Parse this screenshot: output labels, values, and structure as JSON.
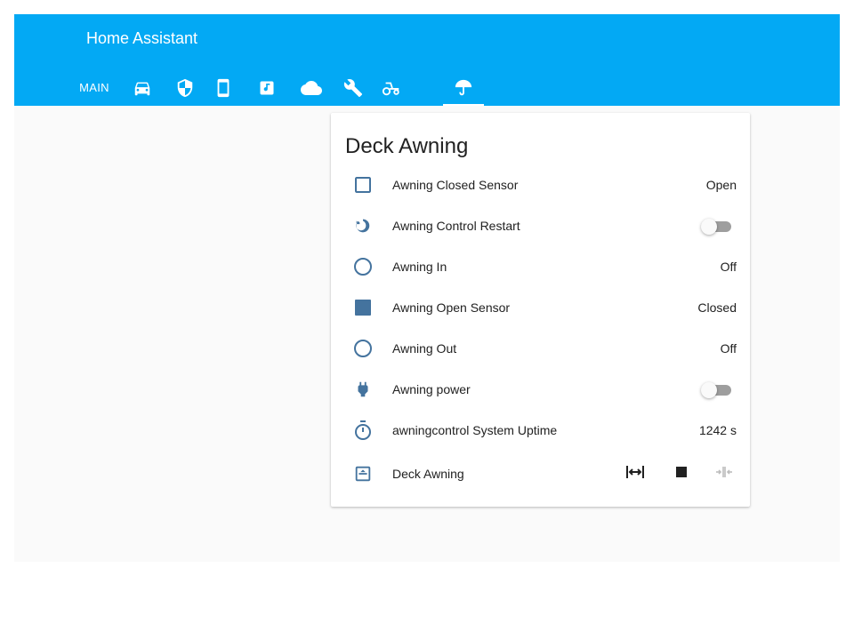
{
  "app": {
    "title": "Home Assistant"
  },
  "tabs": [
    {
      "label": "MAIN",
      "icon": "text"
    },
    {
      "icon": "car-icon"
    },
    {
      "icon": "shield-icon"
    },
    {
      "icon": "phone-icon"
    },
    {
      "icon": "music-note-icon"
    },
    {
      "icon": "cloud-icon"
    },
    {
      "icon": "wrench-icon"
    },
    {
      "icon": "tractor-icon"
    },
    {
      "icon": "umbrella-icon",
      "active": true
    }
  ],
  "card": {
    "title": "Deck Awning",
    "rows": [
      {
        "label": "Awning Closed Sensor",
        "value": "Open",
        "icon": "checkbox-blank-outline-icon"
      },
      {
        "label": "Awning Control Restart",
        "toggle": "off",
        "icon": "restart-icon"
      },
      {
        "label": "Awning In",
        "value": "Off",
        "icon": "circle-outline-icon"
      },
      {
        "label": "Awning Open Sensor",
        "value": "Closed",
        "icon": "checkbox-blank-icon"
      },
      {
        "label": "Awning Out",
        "value": "Off",
        "icon": "circle-outline-icon"
      },
      {
        "label": "Awning power",
        "toggle": "off",
        "icon": "power-plug-icon"
      },
      {
        "label": "awningcontrol System Uptime",
        "value": "1242 s",
        "icon": "timer-icon"
      },
      {
        "label": "Deck Awning",
        "icon": "window-shutter-icon",
        "controls": [
          "open-cover-icon",
          "stop-icon",
          "close-cover-icon"
        ]
      }
    ]
  },
  "colors": {
    "header": "#03a9f4",
    "icon": "#44739e",
    "background": "#fafafa",
    "card": "#ffffff",
    "text": "#212121"
  }
}
